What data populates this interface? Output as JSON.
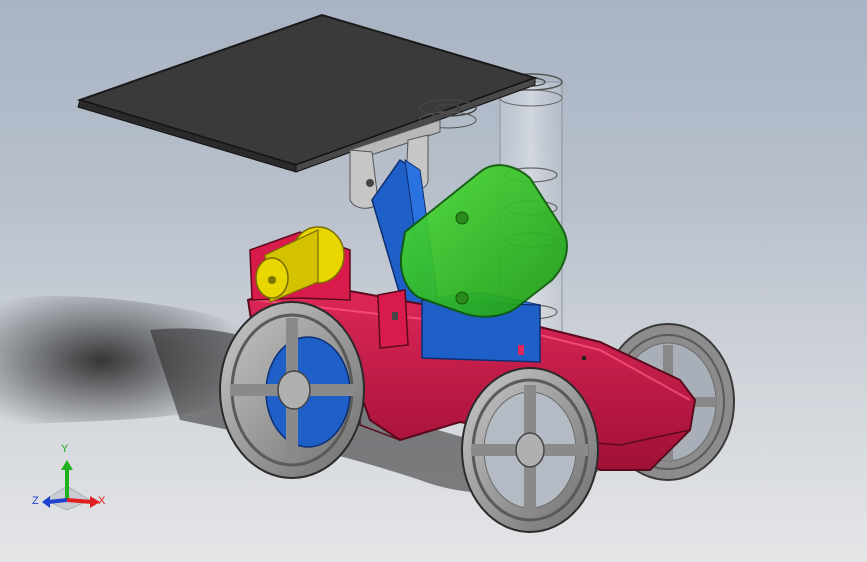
{
  "viewport": {
    "background_top": "#a8b3c3",
    "background_bottom": "#e4e5e7"
  },
  "model": {
    "components": [
      "solar-panel",
      "panel-mount-bracket",
      "support-arm",
      "gear-motor-housing",
      "drive-motor",
      "chassis",
      "front-right-wheel",
      "front-left-wheel",
      "rear-right-wheel",
      "rear-left-wheel",
      "transparent-spring-cylinder"
    ],
    "colors": {
      "chassis": "#d81b4a",
      "solar_panel": "#3c3c3c",
      "support_arm": "#1f5fc8",
      "gear_housing": "#2dbf1f",
      "motor": "#e8d600",
      "wheel": "#9a9a9a"
    }
  },
  "triad": {
    "x_label": "X",
    "y_label": "Y",
    "z_label": "Z",
    "x_color": "#e02020",
    "y_color": "#20b020",
    "z_color": "#2040d0"
  }
}
